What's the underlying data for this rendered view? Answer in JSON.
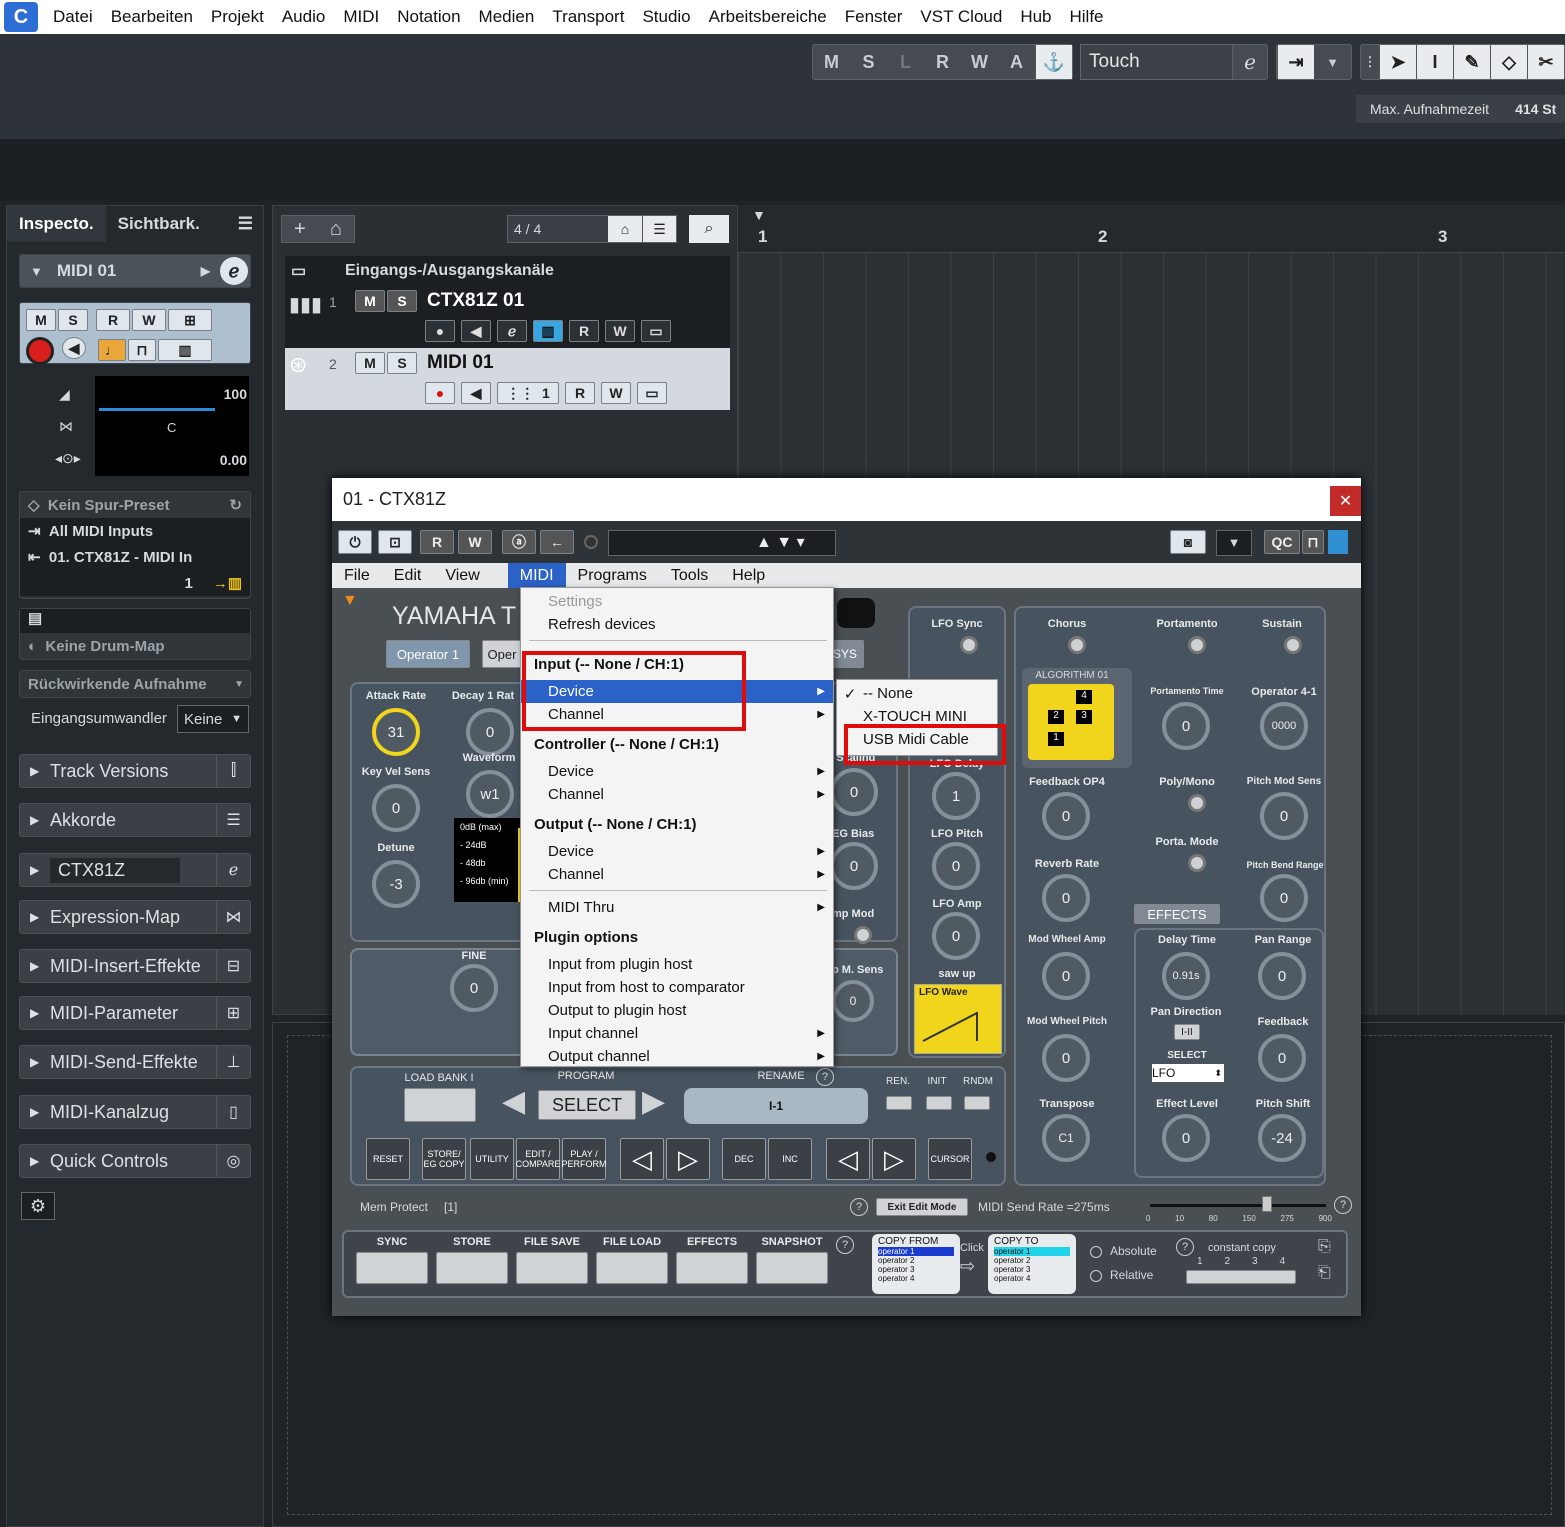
{
  "menubar": {
    "items": [
      "Datei",
      "Bearbeiten",
      "Projekt",
      "Audio",
      "MIDI",
      "Notation",
      "Medien",
      "Transport",
      "Studio",
      "Arbeitsbereiche",
      "Fenster",
      "VST Cloud",
      "Hub",
      "Hilfe"
    ]
  },
  "toolbar": {
    "automation_buttons": [
      "M",
      "S",
      "L",
      "R",
      "W",
      "A"
    ],
    "automation_mode": "Touch",
    "rec_time_label": "Max. Aufnahmezeit",
    "rec_time_value": "414 St"
  },
  "inspector": {
    "tab_inspector": "Inspecto.",
    "tab_visibility": "Sichtbark.",
    "track_name": "MIDI 01",
    "volume": "100",
    "pan": "C",
    "transpose": "0.00",
    "preset": "Kein Spur-Preset",
    "input": "All MIDI Inputs",
    "output": "01. CTX81Z - MIDI In",
    "channel": "1",
    "drum_map": "Keine Drum-Map",
    "retro_record": "Rückwirkende Aufnahme",
    "input_transformer_label": "Eingangsumwandler",
    "input_transformer_value": "Keine",
    "sections": [
      "Track Versions",
      "Akkorde",
      "CTX81Z",
      "Expression-Map",
      "MIDI-Insert-Effekte",
      "MIDI-Parameter",
      "MIDI-Send-Effekte",
      "MIDI-Kanalzug",
      "Quick Controls"
    ]
  },
  "tracklist": {
    "counter": "4 / 4",
    "folder": "Eingangs-/Ausgangskanäle",
    "track1_num": "1",
    "track1_name": "CTX81Z 01",
    "track2_num": "2",
    "track2_name": "MIDI 01",
    "track2_channel": "1"
  },
  "ruler": {
    "marks": [
      "1",
      "2",
      "3"
    ]
  },
  "plugin": {
    "title": "01 - CTX81Z",
    "menu": [
      "File",
      "Edit",
      "View",
      "MIDI",
      "Programs",
      "Tools",
      "Help"
    ],
    "qc": "QC",
    "header_title": "YAMAHA T",
    "tab_op1": "Operator 1",
    "tab_op_partial": "Oper",
    "tab_sys": "SYS",
    "op_labels": {
      "attack": "Attack Rate",
      "decay": "Decay 1 Rat",
      "keyvel": "Key Vel Sens",
      "waveform": "Waveform",
      "detune": "Detune",
      "fine": "FINE",
      "velscaling": "el Scaling",
      "egbias": "EG Bias",
      "ampmod": "mp Mod",
      "pmsens": "p M. Sens"
    },
    "op_values": {
      "attack": "31",
      "decay": "0",
      "keyvel": "0",
      "waveform": "w1",
      "detune": "-3",
      "fine": "0",
      "velscaling": "0",
      "egbias": "0",
      "pmsens": "0"
    },
    "level_meter": [
      "0dB (max)",
      "- 24dB",
      "- 48db",
      "- 96db (min)"
    ],
    "lfo": {
      "sync": "LFO Sync",
      "delay": "LFO Delay",
      "delay_val": "1",
      "pitch": "LFO Pitch",
      "pitch_val": "0",
      "amp": "LFO Amp",
      "amp_val": "0",
      "sawup": "saw up",
      "wave": "LFO Wave"
    },
    "global": {
      "chorus": "Chorus",
      "portamento": "Portamento",
      "sustain": "Sustain",
      "algorithm": "ALGORITHM 01",
      "porta_time": "Portamento Time",
      "porta_time_val": "0",
      "op41": "Operator 4-1",
      "op41_val": "0000",
      "feedback": "Feedback OP4",
      "feedback_val": "0",
      "polymono": "Poly/Mono",
      "pitchmod": "Pitch Mod Sens",
      "pitchmod_val": "0",
      "portamode": "Porta. Mode",
      "reverb": "Reverb Rate",
      "reverb_val": "0",
      "pbrange": "Pitch Bend Range",
      "pbrange_val": "0",
      "effects": "EFFECTS",
      "mwamp": "Mod Wheel Amp",
      "mwamp_val": "0",
      "mwpitch": "Mod Wheel Pitch",
      "mwpitch_val": "0",
      "transpose": "Transpose",
      "transpose_val": "C1"
    },
    "effects": {
      "delay": "Delay Time",
      "delay_val": "0.91s",
      "pan": "Pan Range",
      "pan_val": "0",
      "pandir": "Pan Direction",
      "pandir_val": "I-II",
      "feedback": "Feedback",
      "feedback_val": "0",
      "select": "SELECT",
      "select_val": "LFO",
      "level": "Effect Level",
      "level_val": "0",
      "shift": "Pitch Shift",
      "shift_val": "-24"
    },
    "program": {
      "loadbank": "LOAD BANK I",
      "program": "PROGRAM",
      "select": "SELECT",
      "rename": "RENAME",
      "name": "I-1",
      "ren": "REN.",
      "init": "INIT",
      "rndm": "RNDM"
    },
    "panel_buttons": [
      "RESET",
      "STORE/ EG COPY",
      "UTILITY",
      "EDIT / COMPARE",
      "PLAY / PERFORM",
      "DEC",
      "INC",
      "CURSOR"
    ],
    "status": {
      "memprotect": "Mem Protect",
      "memval": "[1]",
      "exit": "Exit Edit Mode",
      "sendrate": "MIDI Send Rate =275ms",
      "scale": [
        "0",
        "10",
        "80",
        "150",
        "275",
        "900"
      ]
    },
    "bottom": {
      "buttons": [
        "SYNC",
        "STORE",
        "FILE SAVE",
        "FILE LOAD",
        "EFFECTS",
        "SNAPSHOT"
      ],
      "copy_from": "COPY FROM",
      "copy_to": "COPY TO",
      "click": "Click",
      "operators": [
        "operator 1",
        "operator 2",
        "operator 3",
        "operator 4"
      ],
      "absolute": "Absolute",
      "relative": "Relative",
      "constant": "constant copy",
      "nums": [
        "1",
        "2",
        "3",
        "4"
      ]
    }
  },
  "dropdown": {
    "settings": "Settings",
    "refresh": "Refresh devices",
    "input_hdr": "Input (-- None / CH:1)",
    "device": "Device",
    "channel": "Channel",
    "controller_hdr": "Controller (-- None / CH:1)",
    "output_hdr": "Output  (-- None / CH:1)",
    "thru": "MIDI Thru",
    "plugin_hdr": "Plugin options",
    "opt1": "Input from plugin host",
    "opt2": "Input from host to comparator",
    "opt3": "Output to plugin host",
    "opt4": "Input channel",
    "opt5": "Output channel"
  },
  "submenu": {
    "none": "-- None",
    "xtouch": "X-TOUCH MINI",
    "usb": "USB Midi Cable",
    "check": "✓"
  },
  "colors": {
    "accent": "#2a62c8",
    "highlight": "#e00b0b",
    "knob_yellow": "#f1d51d"
  }
}
